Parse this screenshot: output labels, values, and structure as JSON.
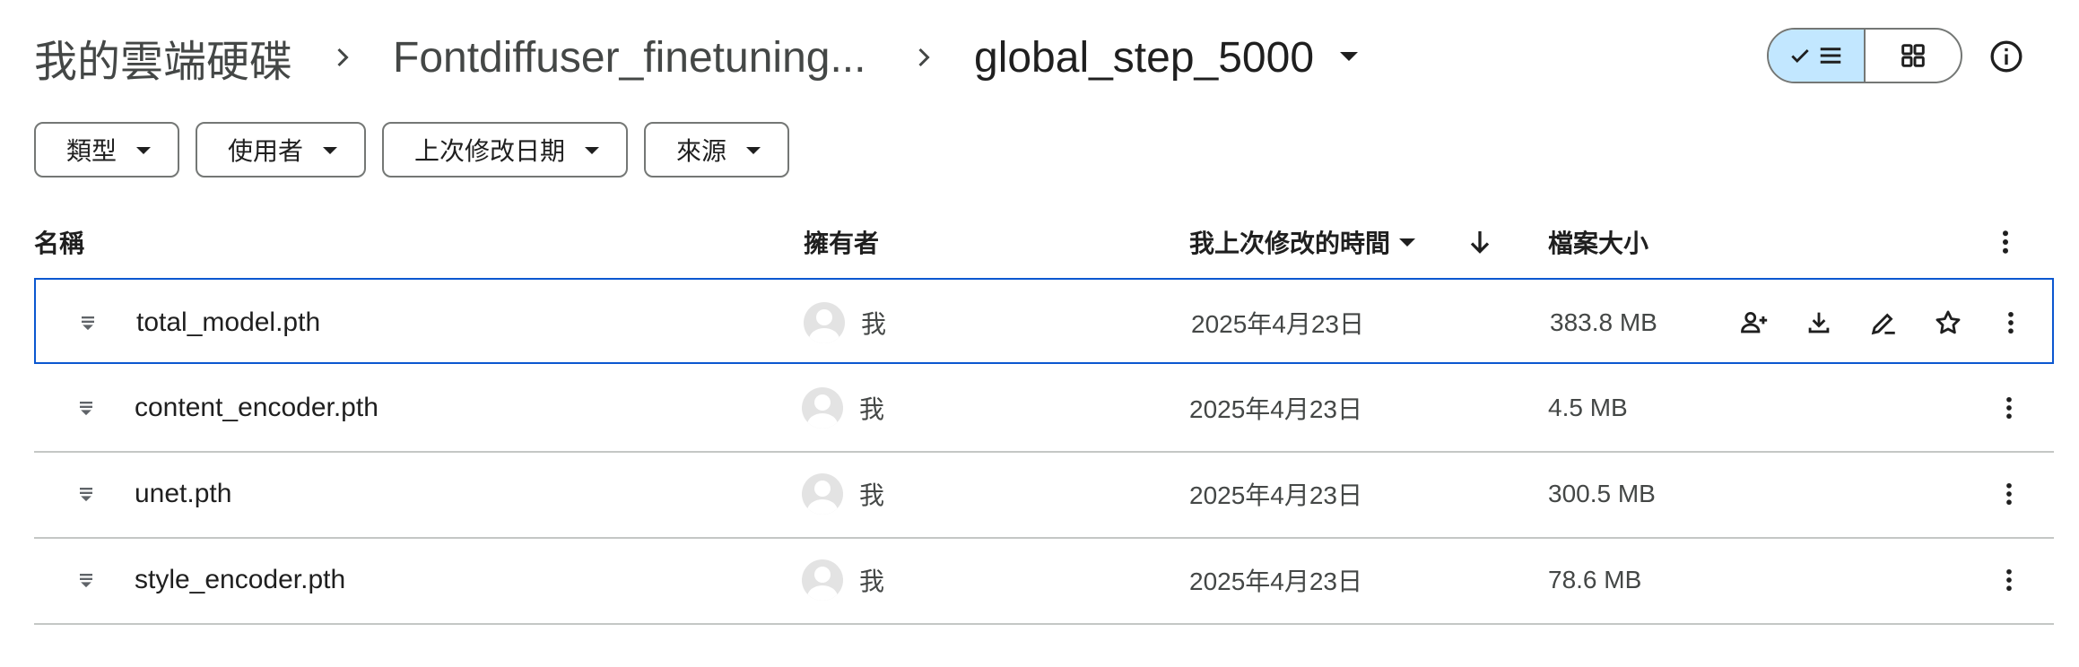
{
  "breadcrumb": {
    "root": "我的雲端硬碟",
    "folder": "Fontdiffuser_finetuning...",
    "current": "global_step_5000"
  },
  "view_toggle": {
    "active": "list"
  },
  "filters": [
    {
      "label": "類型"
    },
    {
      "label": "使用者"
    },
    {
      "label": "上次修改日期"
    },
    {
      "label": "來源"
    }
  ],
  "table": {
    "headers": {
      "name": "名稱",
      "owner": "擁有者",
      "modified": "我上次修改的時間",
      "size": "檔案大小"
    },
    "rows": [
      {
        "name": "total_model.pth",
        "owner": "我",
        "modified": "2025年4月23日",
        "size": "383.8 MB",
        "selected": true
      },
      {
        "name": "content_encoder.pth",
        "owner": "我",
        "modified": "2025年4月23日",
        "size": "4.5 MB",
        "selected": false
      },
      {
        "name": "unet.pth",
        "owner": "我",
        "modified": "2025年4月23日",
        "size": "300.5 MB",
        "selected": false
      },
      {
        "name": "style_encoder.pth",
        "owner": "我",
        "modified": "2025年4月23日",
        "size": "78.6 MB",
        "selected": false
      }
    ]
  },
  "colors": {
    "accent": "#0b57d0",
    "toggle_active_bg": "#c2e7ff",
    "divider": "#c4c7c5"
  },
  "icons": [
    "chevron-right-icon",
    "dropdown-arrow-icon",
    "checkmark-icon",
    "list-view-icon",
    "grid-view-icon",
    "info-icon",
    "sort-arrow-down-icon",
    "more-vert-icon",
    "file-icon",
    "avatar-icon",
    "share-icon",
    "download-icon",
    "rename-icon",
    "star-icon"
  ]
}
